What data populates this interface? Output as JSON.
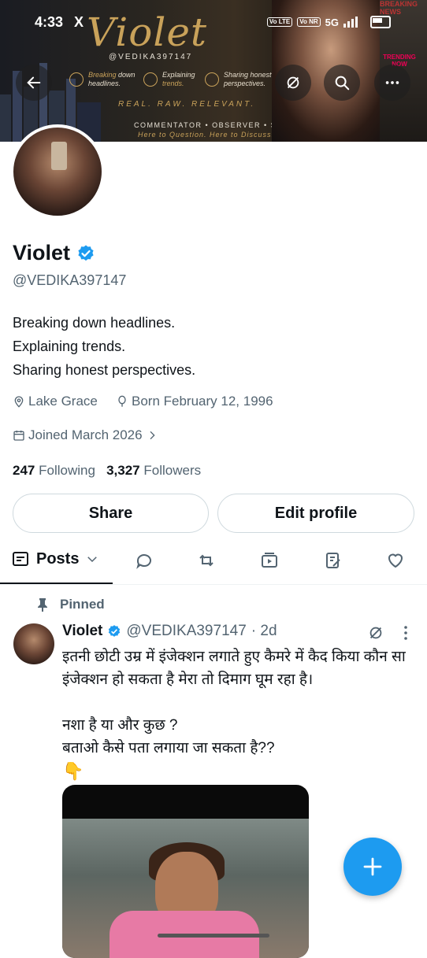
{
  "status_bar": {
    "time": "4:33",
    "app_glyph": "X",
    "network": "5G",
    "sim1_label": "Vo LTE",
    "sim2_label": "Vo NR"
  },
  "banner": {
    "title": "Violet",
    "handle": "@VEDIKA397147",
    "features": [
      {
        "accent": "Breaking",
        "rest": " down",
        "line2": "headlines."
      },
      {
        "accent": "",
        "rest": "Explaining",
        "line2": "trends."
      },
      {
        "accent": "",
        "rest": "Sharing honest",
        "line2": "perspectives."
      }
    ],
    "tagline": "REAL. RAW. RELEVANT.",
    "roles": "COMMENTATOR • OBSERVER • STORYTELLER",
    "subline": "Here to Question. Here to Discuss. Here to Tell.",
    "news_badge": "BREAKING NEWS",
    "trend_label": "TRENDING NOW"
  },
  "profile": {
    "name": "Violet",
    "handle": "@VEDIKA397147",
    "bio": [
      "Breaking down headlines.",
      "Explaining trends.",
      "Sharing honest perspectives."
    ],
    "location": "Lake Grace",
    "born": "Born February 12, 1996",
    "joined": "Joined March 2026",
    "following_count": "247",
    "following_label": "Following",
    "followers_count": "3,327",
    "followers_label": "Followers",
    "verified_color": "#1d9bf0"
  },
  "actions": {
    "share": "Share",
    "edit": "Edit profile"
  },
  "tabs": {
    "posts": "Posts"
  },
  "pinned_post": {
    "pinned_label": "Pinned",
    "author": "Violet",
    "handle": "@VEDIKA397147",
    "time": "· 2d",
    "text1": "इतनी छोटी उम्र में इंजेक्शन लगाते हुए कैमरे में कैद किया कौन सा इंजेक्शन हो सकता है मेरा तो दिमाग घूम रहा है।",
    "text2": "नशा है या और कुछ ?",
    "text3": "बताओ कैसे पता लगाया जा सकता है??",
    "emoji": "👇"
  },
  "colors": {
    "accent": "#1d9bf0",
    "secondary_text": "#536471",
    "banner_gold": "#c9a25a"
  }
}
